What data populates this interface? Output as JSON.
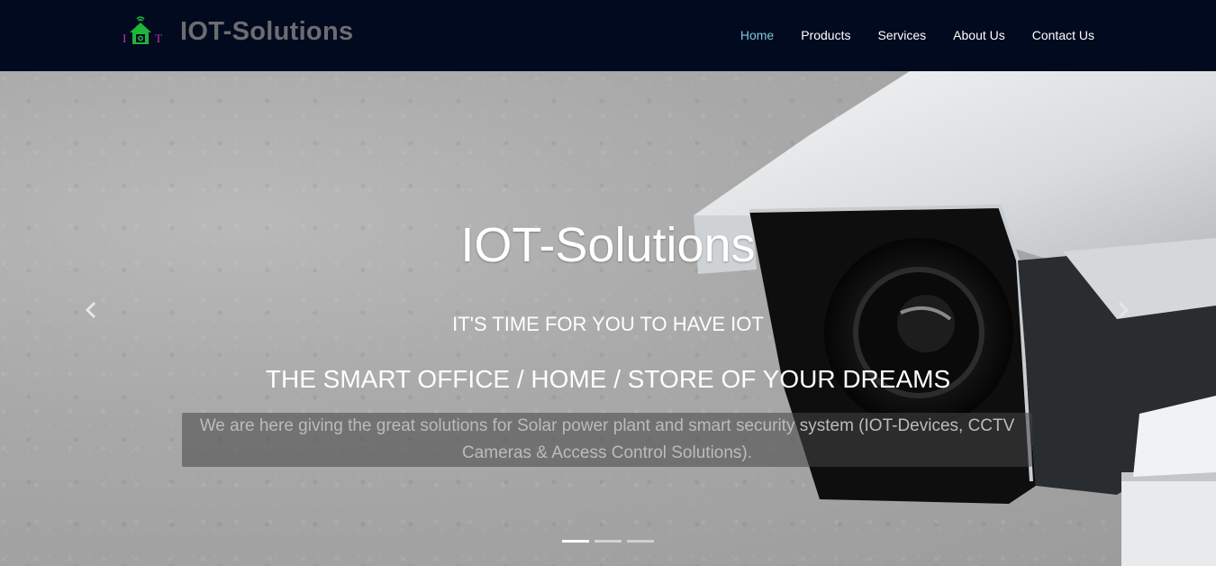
{
  "brand": {
    "name": "IOT-Solutions",
    "logo_letters": [
      "I",
      "O",
      "T"
    ]
  },
  "nav": {
    "items": [
      {
        "label": "Home",
        "active": true
      },
      {
        "label": "Products",
        "active": false
      },
      {
        "label": "Services",
        "active": false
      },
      {
        "label": "About Us",
        "active": false
      },
      {
        "label": "Contact Us",
        "active": false
      }
    ]
  },
  "hero": {
    "title": "IOT-Solutions",
    "subtitle": "IT'S TIME FOR YOU TO HAVE IOT",
    "tagline": "THE SMART OFFICE / HOME / STORE OF YOUR DREAMS",
    "description": "We are here giving the great solutions for Solar power plant and smart security system (IOT-Devices, CCTV Cameras & Access Control Solutions).",
    "slide_count": 3,
    "active_slide": 1
  },
  "colors": {
    "navbar_bg": "#010a1f",
    "brand_text": "#6c6d71",
    "nav_active": "#7ec8da",
    "nav_text": "#ffffff",
    "logo_green": "#1fb53a",
    "logo_magenta": "#d42bb4"
  },
  "icons": {
    "prev": "chevron-left-icon",
    "next": "chevron-right-icon",
    "logo": "smart-home-wifi-icon"
  }
}
